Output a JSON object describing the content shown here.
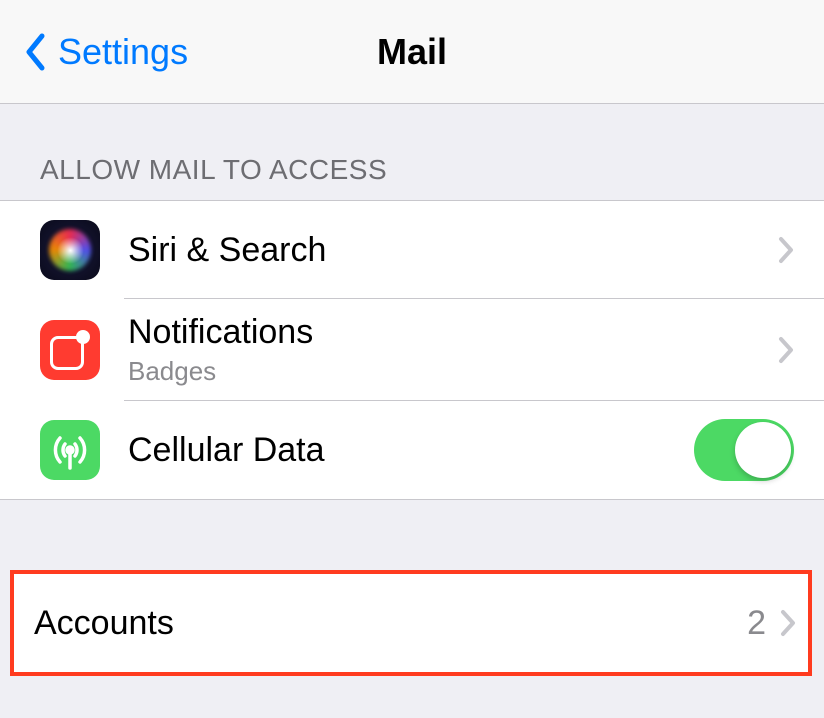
{
  "nav": {
    "back_label": "Settings",
    "title": "Mail"
  },
  "section1": {
    "header": "ALLOW MAIL TO ACCESS",
    "rows": [
      {
        "title": "Siri & Search",
        "icon": "siri"
      },
      {
        "title": "Notifications",
        "subtitle": "Badges",
        "icon": "notifications"
      },
      {
        "title": "Cellular Data",
        "icon": "cellular",
        "switch_on": true
      }
    ]
  },
  "accounts": {
    "label": "Accounts",
    "count": "2"
  }
}
